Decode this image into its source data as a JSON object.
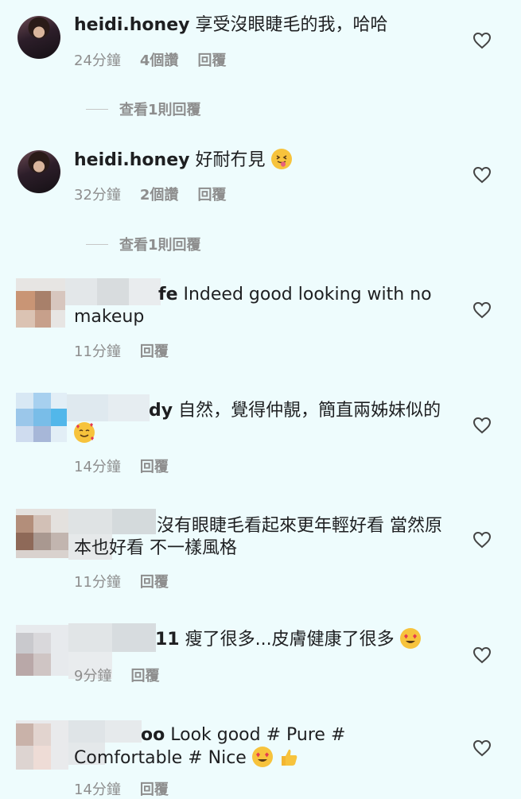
{
  "comments": [
    {
      "username": "heidi.honey",
      "text": "享受沒眼睫毛的我，哈哈",
      "time": "24分鐘",
      "likes": "4個讚",
      "reply": "回覆",
      "view_replies": "查看1則回覆"
    },
    {
      "username": "heidi.honey",
      "text": "好耐冇見",
      "emoji": "squinting-face-with-tongue",
      "time": "32分鐘",
      "likes": "2個讚",
      "reply": "回覆",
      "view_replies": "查看1則回覆"
    },
    {
      "username_partial": "fe",
      "text": "Indeed good looking with no makeup",
      "time": "11分鐘",
      "reply": "回覆"
    },
    {
      "username_partial": "dy",
      "text": "自然，覺得仲靚，簡直兩姊妹似的",
      "emoji": "smiling-face-with-hearts",
      "time": "14分鐘",
      "reply": "回覆"
    },
    {
      "text": "沒有眼睫毛看起來更年輕好看 當然原本也好看 不一樣風格",
      "time": "11分鐘",
      "reply": "回覆"
    },
    {
      "username_partial": "11",
      "text": "瘦了很多...皮膚健康了很多",
      "emoji": "smiling-face-with-heart-eyes",
      "time": "9分鐘",
      "reply": "回覆"
    },
    {
      "username_partial": "oo",
      "text": "Look good # Pure # Comfortable # Nice",
      "emoji": "heart-eyes-and-thumbs-up",
      "time": "14分鐘",
      "reply": "回覆"
    }
  ],
  "colors": {
    "background": "#eefcfd",
    "text": "#1e1f21",
    "meta": "#8e8e8e"
  }
}
